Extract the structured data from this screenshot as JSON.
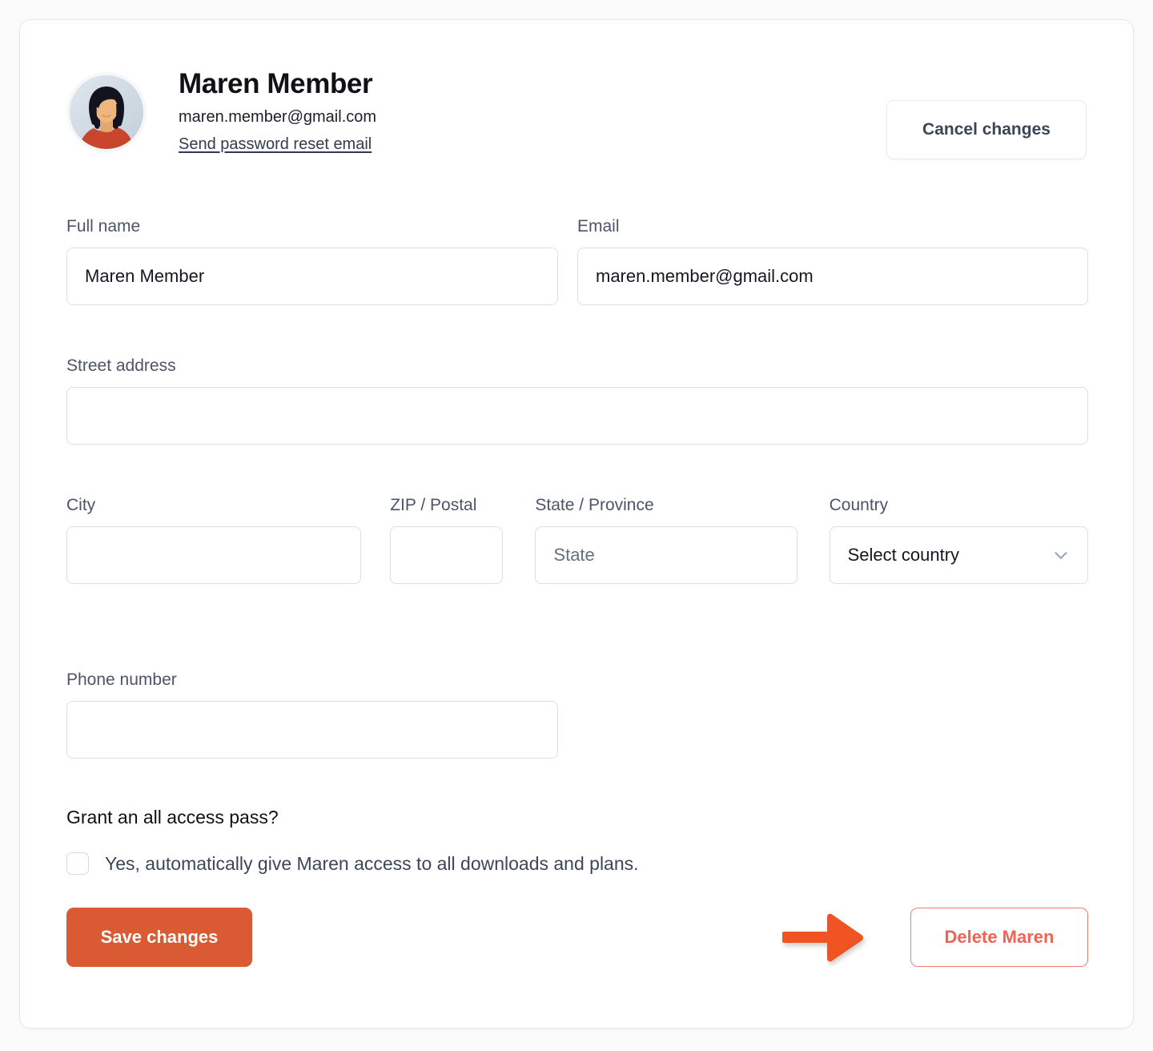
{
  "profile": {
    "name": "Maren Member",
    "email": "maren.member@gmail.com",
    "reset_link": "Send password reset email",
    "avatar_alt": "member-avatar"
  },
  "header": {
    "cancel_label": "Cancel changes"
  },
  "form": {
    "full_name": {
      "label": "Full name",
      "value": "Maren Member",
      "placeholder": ""
    },
    "email": {
      "label": "Email",
      "value": "maren.member@gmail.com",
      "placeholder": ""
    },
    "street_address": {
      "label": "Street address",
      "value": "",
      "placeholder": ""
    },
    "city": {
      "label": "City",
      "value": "",
      "placeholder": ""
    },
    "zip": {
      "label": "ZIP / Postal",
      "value": "",
      "placeholder": ""
    },
    "state": {
      "label": "State / Province",
      "value": "",
      "placeholder": "State"
    },
    "country": {
      "label": "Country",
      "value": "Select country",
      "options": [
        "Select country"
      ]
    },
    "phone": {
      "label": "Phone number",
      "value": "",
      "placeholder": ""
    }
  },
  "access_pass": {
    "title": "Grant an all access pass?",
    "checkbox_label": "Yes, automatically give Maren access to all downloads and plans.",
    "checked": false
  },
  "footer": {
    "save_label": "Save changes",
    "delete_label": "Delete Maren"
  },
  "colors": {
    "primary": "#d95a33",
    "danger": "#ee6352",
    "arrow": "#f05423",
    "border": "#dcdfe4",
    "label": "#4b5468"
  }
}
